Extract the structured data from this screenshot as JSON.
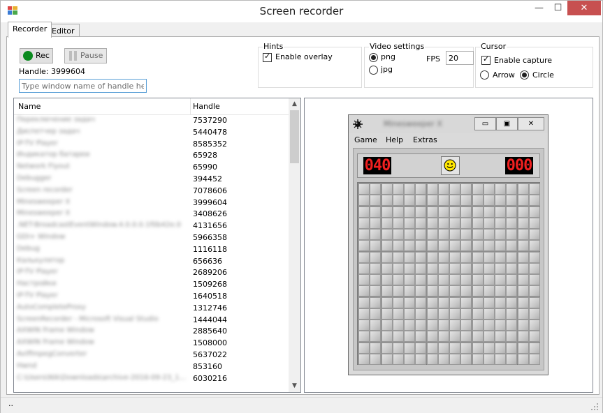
{
  "window": {
    "title": "Screen recorder",
    "minimize_glyph": "—",
    "maximize_glyph": "☐",
    "close_glyph": "✕"
  },
  "tabs": [
    {
      "label": "Recorder"
    },
    {
      "label": "Editor"
    }
  ],
  "recorder": {
    "rec_label": "Rec",
    "pause_label": "Pause",
    "handle_text": "Handle: 3999604",
    "search_placeholder": "Type window name of handle here"
  },
  "hints": {
    "legend": "Hints",
    "enable_overlay": "Enable overlay"
  },
  "video_settings": {
    "legend": "Video settings",
    "png": "png",
    "jpg": "jpg",
    "fps_label": "FPS",
    "fps_value": "20"
  },
  "cursor": {
    "legend": "Cursor",
    "enable_capture": "Enable capture",
    "arrow": "Arrow",
    "circle": "Circle"
  },
  "list": {
    "columns": [
      "Name",
      "Handle"
    ],
    "rows": [
      {
        "name": "Переключение задач",
        "handle": "7537290"
      },
      {
        "name": "Диспетчер задач",
        "handle": "5440478"
      },
      {
        "name": "IP-TV Player",
        "handle": "8585352"
      },
      {
        "name": "Индикатор батареи",
        "handle": "65928"
      },
      {
        "name": "Network Flyout",
        "handle": "65990"
      },
      {
        "name": "Debugger",
        "handle": "394452"
      },
      {
        "name": "Screen recorder",
        "handle": "7078606"
      },
      {
        "name": "Minesweeper X",
        "handle": "3999604"
      },
      {
        "name": "Minesweeper X",
        "handle": "3408626"
      },
      {
        "name": ".NET-BroadcastEventWindow.4.0.0.0.1f0b42e.0",
        "handle": "4131656"
      },
      {
        "name": "GDI+ Window",
        "handle": "5966358"
      },
      {
        "name": "Debug",
        "handle": "1116118"
      },
      {
        "name": "Калькулятор",
        "handle": "656636"
      },
      {
        "name": "IP-TV Player",
        "handle": "2689206"
      },
      {
        "name": "Настройки",
        "handle": "1509268"
      },
      {
        "name": "IP-TV Player",
        "handle": "1640518"
      },
      {
        "name": "AutoCompleteProxy",
        "handle": "1312746"
      },
      {
        "name": "ScreenRecorder - Microsoft Visual Studio",
        "handle": "1444044"
      },
      {
        "name": "AXWIN Frame Window",
        "handle": "2885640"
      },
      {
        "name": "AXWIN Frame Window",
        "handle": "1508000"
      },
      {
        "name": "AviffmpegConverter",
        "handle": "5637022"
      },
      {
        "name": "Hwnd",
        "handle": "853160"
      },
      {
        "name": "C:\\Users\\Nik\\Downloads\\archive-2016-09-23_1...",
        "handle": "6030216"
      }
    ],
    "scroll_up_glyph": "▲",
    "scroll_down_glyph": "▼"
  },
  "preview": {
    "title": "Minesweeper X",
    "btn_min": "▭",
    "btn_max": "▣",
    "btn_close": "✕",
    "menu": [
      "Game",
      "Help",
      "Extras"
    ],
    "mines_counter": "040",
    "timer": "000",
    "grid_cols": 16,
    "grid_rows": 16
  },
  "status": {
    "text": ".."
  },
  "colors": {
    "rec": "#0a8a1e",
    "close": "#c75050",
    "digits": "#f02020"
  }
}
